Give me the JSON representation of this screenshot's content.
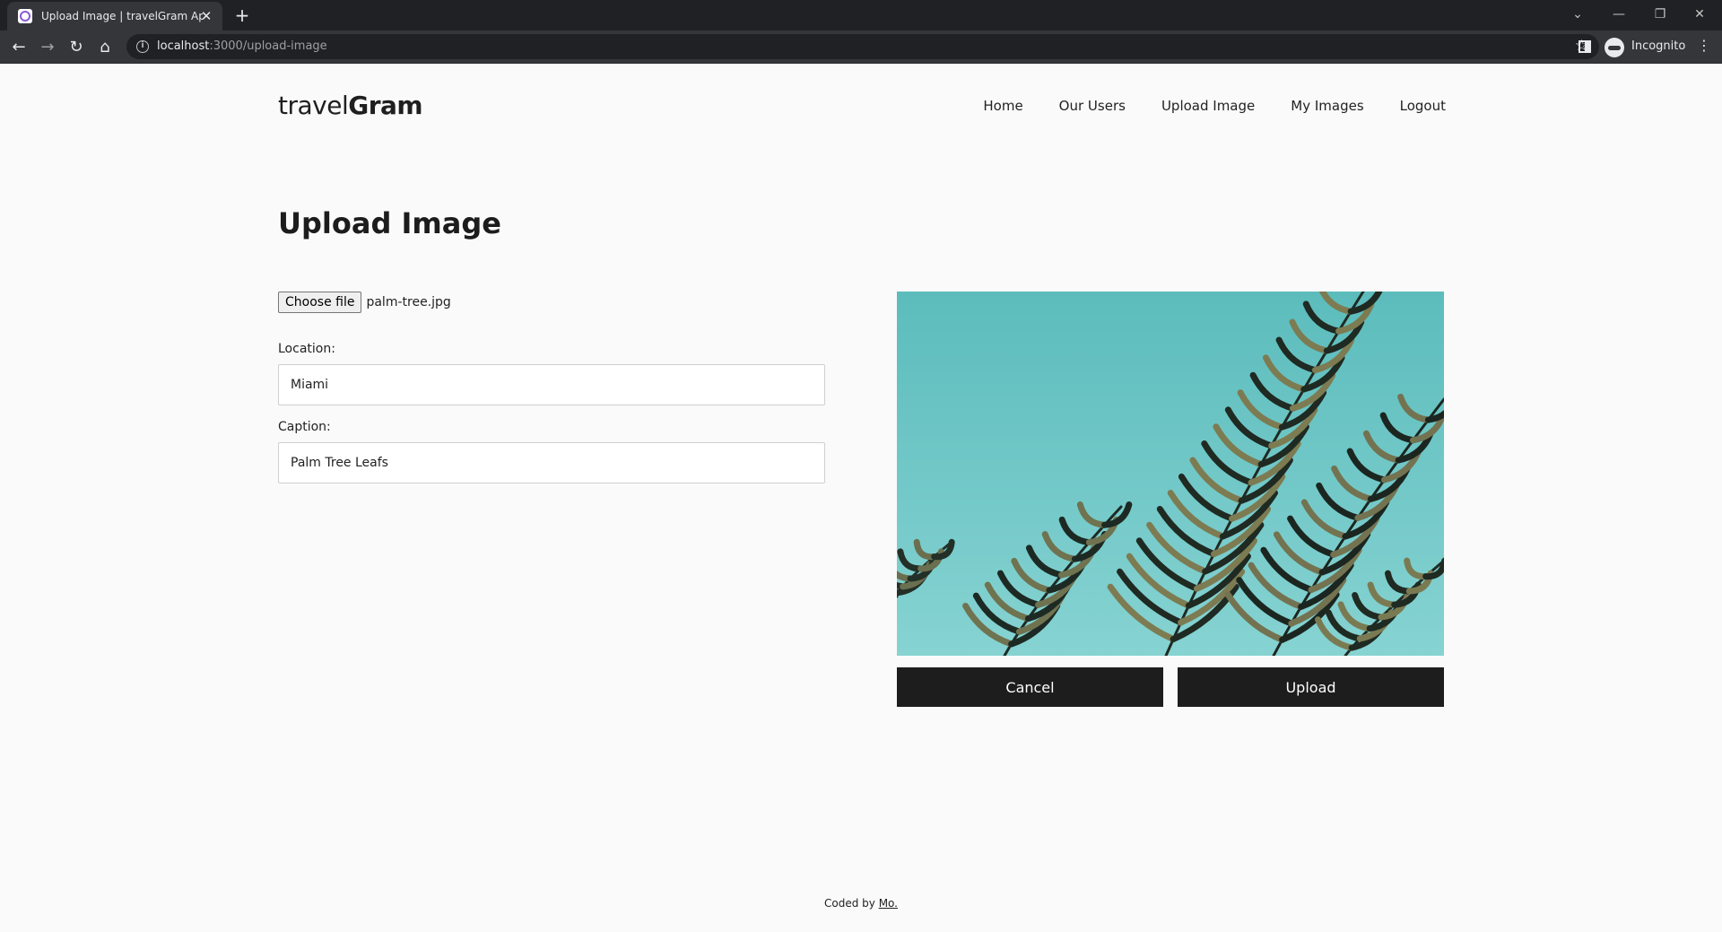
{
  "browser": {
    "tab_title": "Upload Image | travelGram App",
    "url_host": "localhost",
    "url_path": ":3000/upload-image",
    "profile_label": "Incognito"
  },
  "brand": {
    "light": "travel",
    "bold": "Gram"
  },
  "nav": {
    "home": "Home",
    "our_users": "Our Users",
    "upload_image": "Upload Image",
    "my_images": "My Images",
    "logout": "Logout"
  },
  "page_title": "Upload Image",
  "form": {
    "choose_file_label": "Choose file",
    "file_name": "palm-tree.jpg",
    "location_label": "Location:",
    "location_value": "Miami",
    "caption_label": "Caption:",
    "caption_value": "Palm Tree Leafs"
  },
  "preview": {
    "description_icon": "palm-tree-image",
    "sky_color": "#6cc6c5",
    "leaf_color": "#7a7a52"
  },
  "buttons": {
    "cancel": "Cancel",
    "upload": "Upload"
  },
  "footer": {
    "prefix": "Coded by ",
    "author": "Mo."
  }
}
